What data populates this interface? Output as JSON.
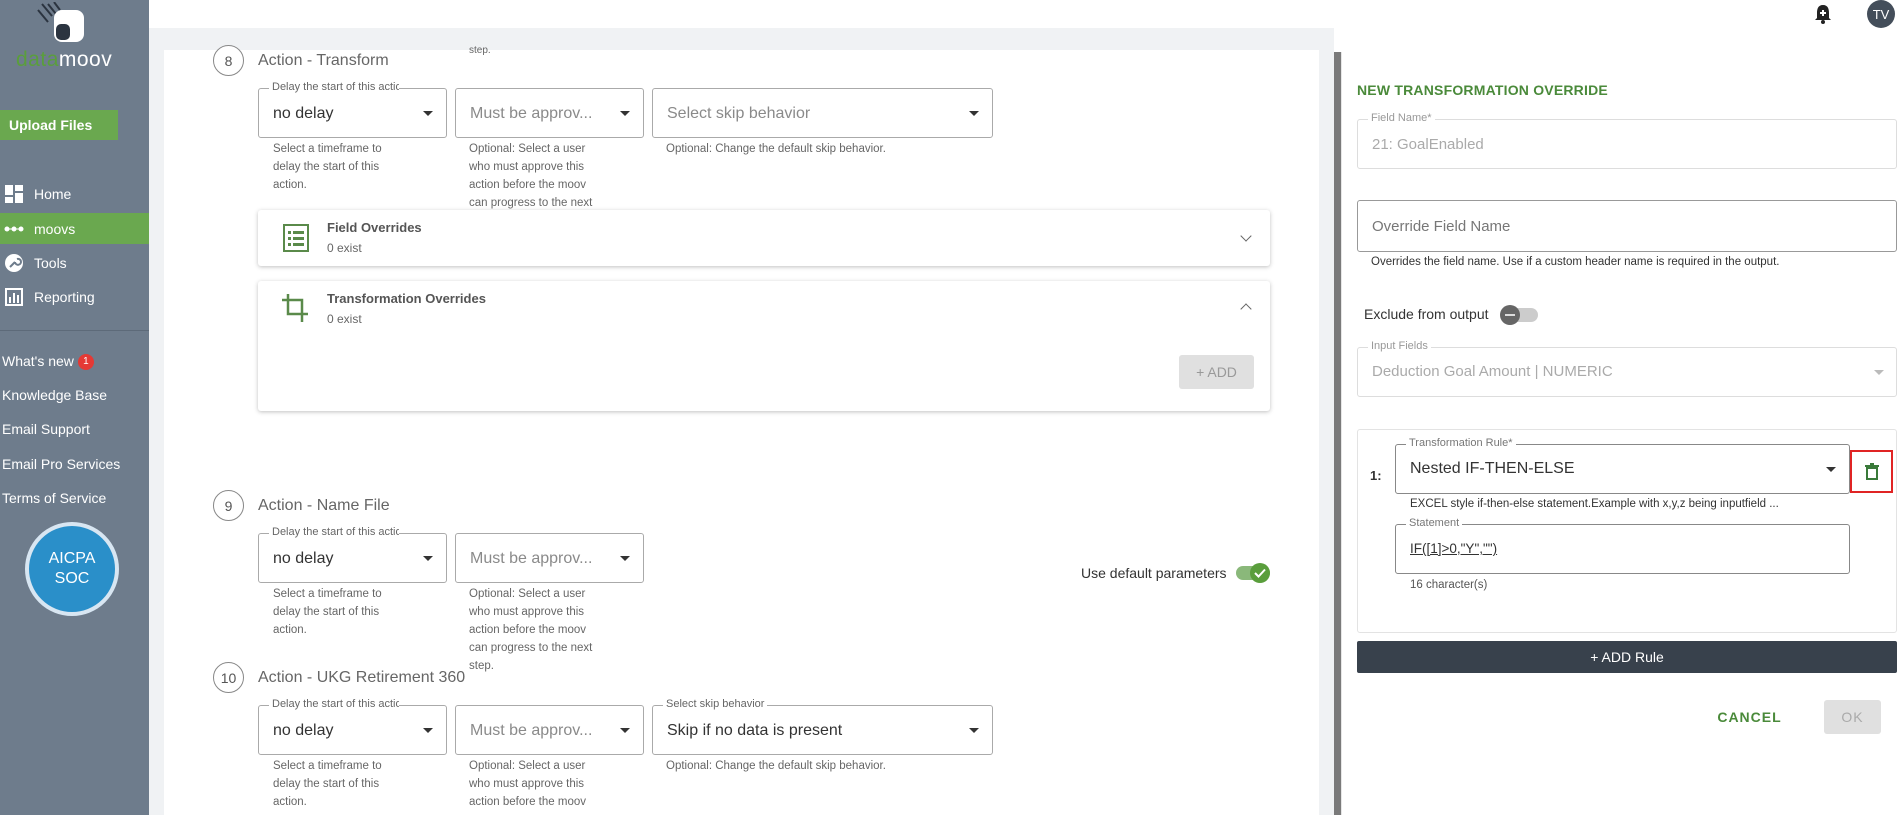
{
  "sidebar": {
    "logo_part1": "data",
    "logo_part2": "moov",
    "upload_label": "Upload Files",
    "nav": [
      {
        "label": "Home",
        "icon": "dashboard-icon"
      },
      {
        "label": "moovs",
        "icon": "dots-icon",
        "active": true
      },
      {
        "label": "Tools",
        "icon": "wrench-icon"
      },
      {
        "label": "Reporting",
        "icon": "chart-icon"
      }
    ],
    "links": {
      "whats_new": "What's new",
      "whats_new_count": "1",
      "knowledge_base": "Knowledge Base",
      "email_support": "Email Support",
      "email_pro": "Email Pro Services",
      "terms": "Terms of Service"
    },
    "soc_line1": "AICPA",
    "soc_line2": "SOC"
  },
  "topbar": {
    "avatar_initials": "TV"
  },
  "steps": [
    {
      "number": "8",
      "title": "Action - Transform",
      "delay_label": "Delay the start of this action",
      "delay_value": "no delay",
      "delay_help": [
        "Select a timeframe to",
        "delay the start of this",
        "action."
      ],
      "approve_placeholder": "Must be approv...",
      "approve_help": [
        "Optional: Select a user",
        "who must approve this",
        "action before the moov",
        "can progress to the next"
      ],
      "skip_placeholder": "Select skip behavior",
      "skip_help": "Optional: Change the default skip behavior.",
      "partial_text": "step."
    },
    {
      "number": "9",
      "title": "Action - Name File",
      "delay_label": "Delay the start of this action",
      "delay_value": "no delay",
      "delay_help": [
        "Select a timeframe to",
        "delay the start of this",
        "action."
      ],
      "approve_placeholder": "Must be approv...",
      "approve_help": [
        "Optional: Select a user",
        "who must approve this",
        "action before the moov",
        "can progress to the next",
        "step."
      ],
      "default_params_label": "Use default parameters"
    },
    {
      "number": "10",
      "title": "Action - UKG Retirement 360",
      "delay_label": "Delay the start of this action",
      "delay_value": "no delay",
      "delay_help": [
        "Select a timeframe to",
        "delay the start of this",
        "action."
      ],
      "approve_placeholder": "Must be approv...",
      "approve_help": [
        "Optional: Select a user",
        "who must approve this",
        "action before the moov"
      ],
      "skip_label": "Select skip behavior",
      "skip_value": "Skip if no data is present",
      "skip_help": "Optional: Change the default skip behavior."
    }
  ],
  "accordions": {
    "field_overrides_title": "Field Overrides",
    "field_overrides_sub": "0 exist",
    "transformation_overrides_title": "Transformation Overrides",
    "transformation_overrides_sub": "0 exist",
    "add_label": "+ ADD"
  },
  "panel": {
    "title": "NEW TRANSFORMATION OVERRIDE",
    "field_name_label": "Field Name*",
    "field_name_value": "21: GoalEnabled",
    "override_placeholder": "Override Field Name",
    "override_help": "Overrides the field name. Use if a custom header name is required in the output.",
    "exclude_label": "Exclude from output",
    "input_fields_label": "Input Fields",
    "input_fields_value": "Deduction Goal Amount | NUMERIC",
    "rule_index": "1:",
    "rule_label": "Transformation Rule*",
    "rule_value": "Nested IF-THEN-ELSE",
    "rule_help": "EXCEL style if-then-else statement.Example with x,y,z being inputfield ...",
    "statement_label": "Statement",
    "statement_value": "IF([1]>0,\"Y\",\"\")",
    "char_count": "16 character(s)",
    "add_rule_label": "+ ADD Rule",
    "cancel_label": "CANCEL",
    "ok_label": "OK"
  },
  "colors": {
    "sidebar_bg": "#6e7c8c",
    "accent_green": "#6aa84f",
    "title_green": "#4a8a3a",
    "dark_button": "#38414c",
    "delete_border": "#e02424"
  }
}
